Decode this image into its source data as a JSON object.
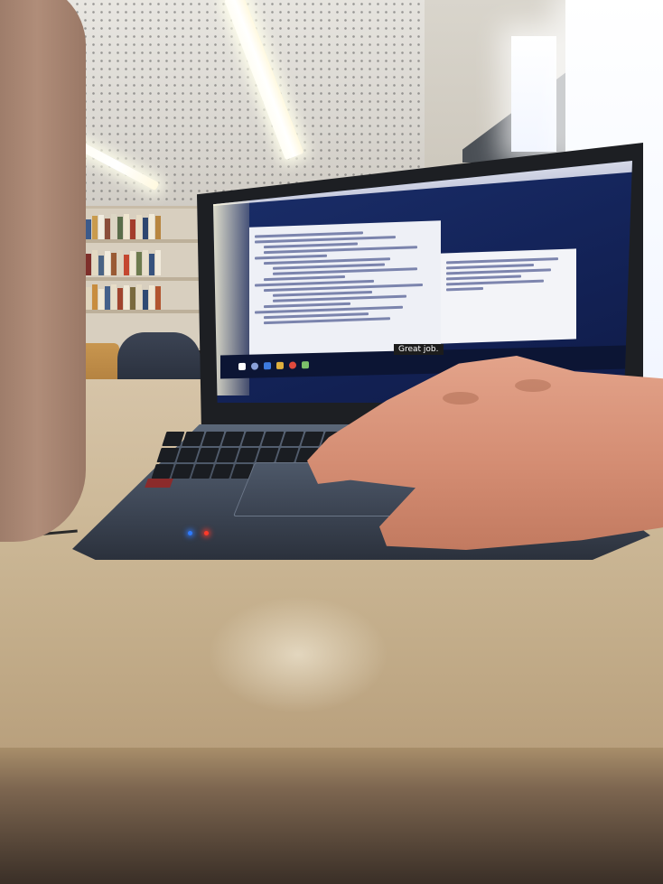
{
  "scene": {
    "description_type": "photo",
    "screen_toast_text": "Great job.",
    "colors": {
      "screen_background": "#14245a",
      "led_blue": "#2f7bff",
      "led_red": "#ff3a2a",
      "table": "#cdb998"
    },
    "icons": [
      "laptop-icon",
      "hand-icon"
    ]
  }
}
